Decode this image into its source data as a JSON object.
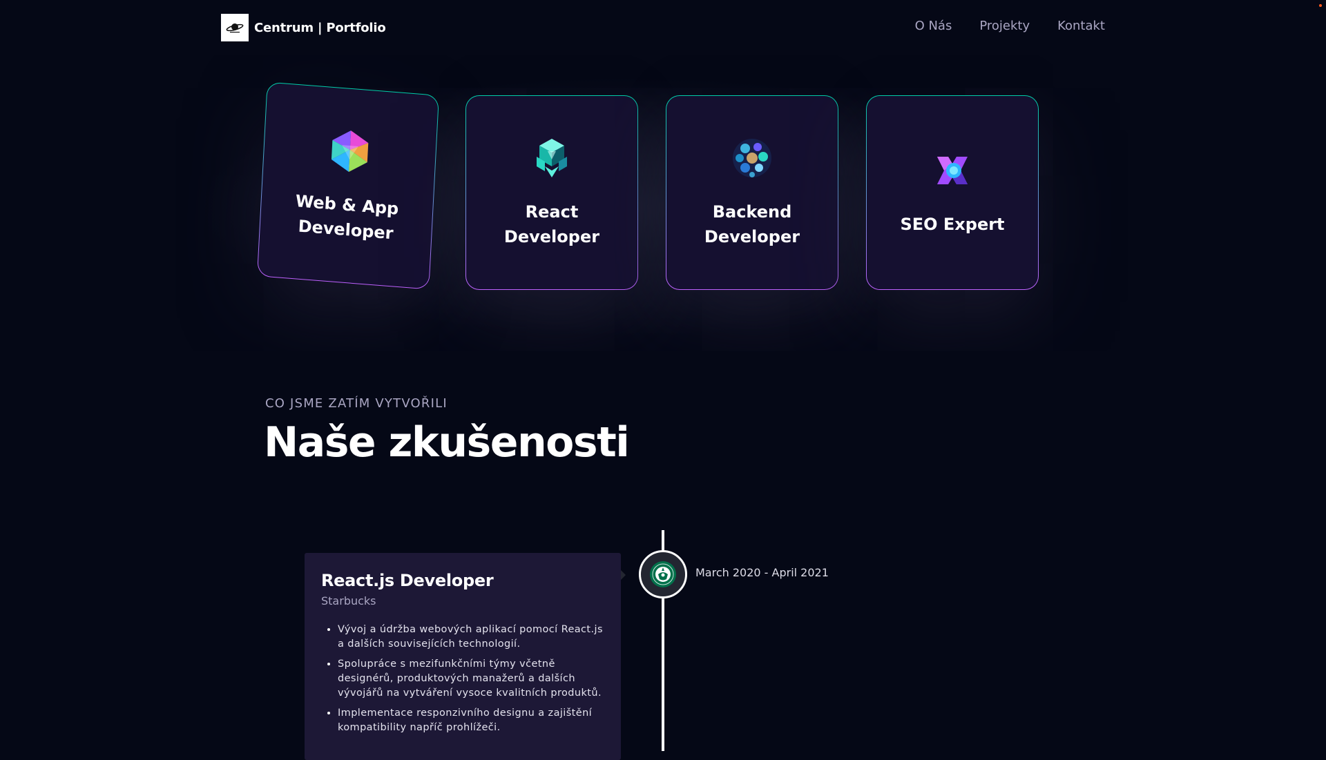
{
  "navbar": {
    "brand_name": "Centrum | Portfolio",
    "logo_icon": "planet-logo-icon",
    "links": [
      "O Nás",
      "Projekty",
      "Kontakt"
    ]
  },
  "services": [
    {
      "title": "Web & App Developer",
      "icon": "gem-icon"
    },
    {
      "title": "React Developer",
      "icon": "react-cube-icon"
    },
    {
      "title": "Backend Developer",
      "icon": "sphere-icon"
    },
    {
      "title": "SEO Expert",
      "icon": "seo-shape-icon"
    }
  ],
  "experience_section": {
    "subtitle": "Co jsme zatím vytvořili",
    "title": "Naše zkušenosti"
  },
  "experiences": [
    {
      "title": "React.js Developer",
      "company": "Starbucks",
      "date": "March 2020 - April 2021",
      "icon": "starbucks-logo-icon",
      "points": [
        "Vývoj a údržba webových aplikací pomocí React.js a dalších souvisejících technologií.",
        "Spolupráce s mezifunkčními týmy včetně designérů, produktových manažerů a dalších vývojářů na vytváření vysoce kvalitních produktů.",
        "Implementace responzivního designu a zajištění kompatibility napříč prohlížeči."
      ]
    }
  ],
  "colors": {
    "background": "#050816",
    "card": "#151030",
    "card_border_top": "#00cea8",
    "card_border_bottom": "#bf61ff",
    "experience_card": "#1d1836",
    "secondary_text": "#aaa6c3"
  }
}
